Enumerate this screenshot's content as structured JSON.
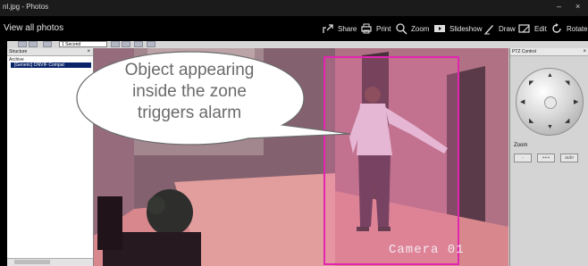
{
  "window": {
    "title": "nl.jpg - Photos",
    "minimize": "–",
    "close": "×"
  },
  "toolbar": {
    "back_label": "View all photos",
    "actions": [
      {
        "label": "Share",
        "icon": "share-icon"
      },
      {
        "label": "Print",
        "icon": "print-icon"
      },
      {
        "label": "Zoom",
        "icon": "zoom-icon"
      },
      {
        "label": "Slideshow",
        "icon": "slideshow-icon"
      },
      {
        "label": "Draw",
        "icon": "draw-icon"
      },
      {
        "label": "Edit",
        "icon": "edit-icon"
      },
      {
        "label": "Rotate",
        "icon": "rotate-icon"
      }
    ]
  },
  "app": {
    "interval_select": "1 Second",
    "structure": {
      "title": "Structure",
      "close": "×",
      "root": "Archive",
      "node": "[Generic] ONVIF Compat"
    },
    "video": {
      "camera_label": "Camera 01"
    },
    "ptz": {
      "title": "PTZ Control",
      "close": "×",
      "zoom_label": "Zoom",
      "zoom_buttons": [
        "-",
        "+++",
        "auto"
      ]
    }
  },
  "callout": {
    "text_lines": [
      "Object appearing",
      "inside the zone",
      "triggers alarm"
    ]
  },
  "colors": {
    "zone_outline": "#e020b0",
    "zone_fill": "#f07ab0",
    "tree_highlight": "#0a246a"
  }
}
